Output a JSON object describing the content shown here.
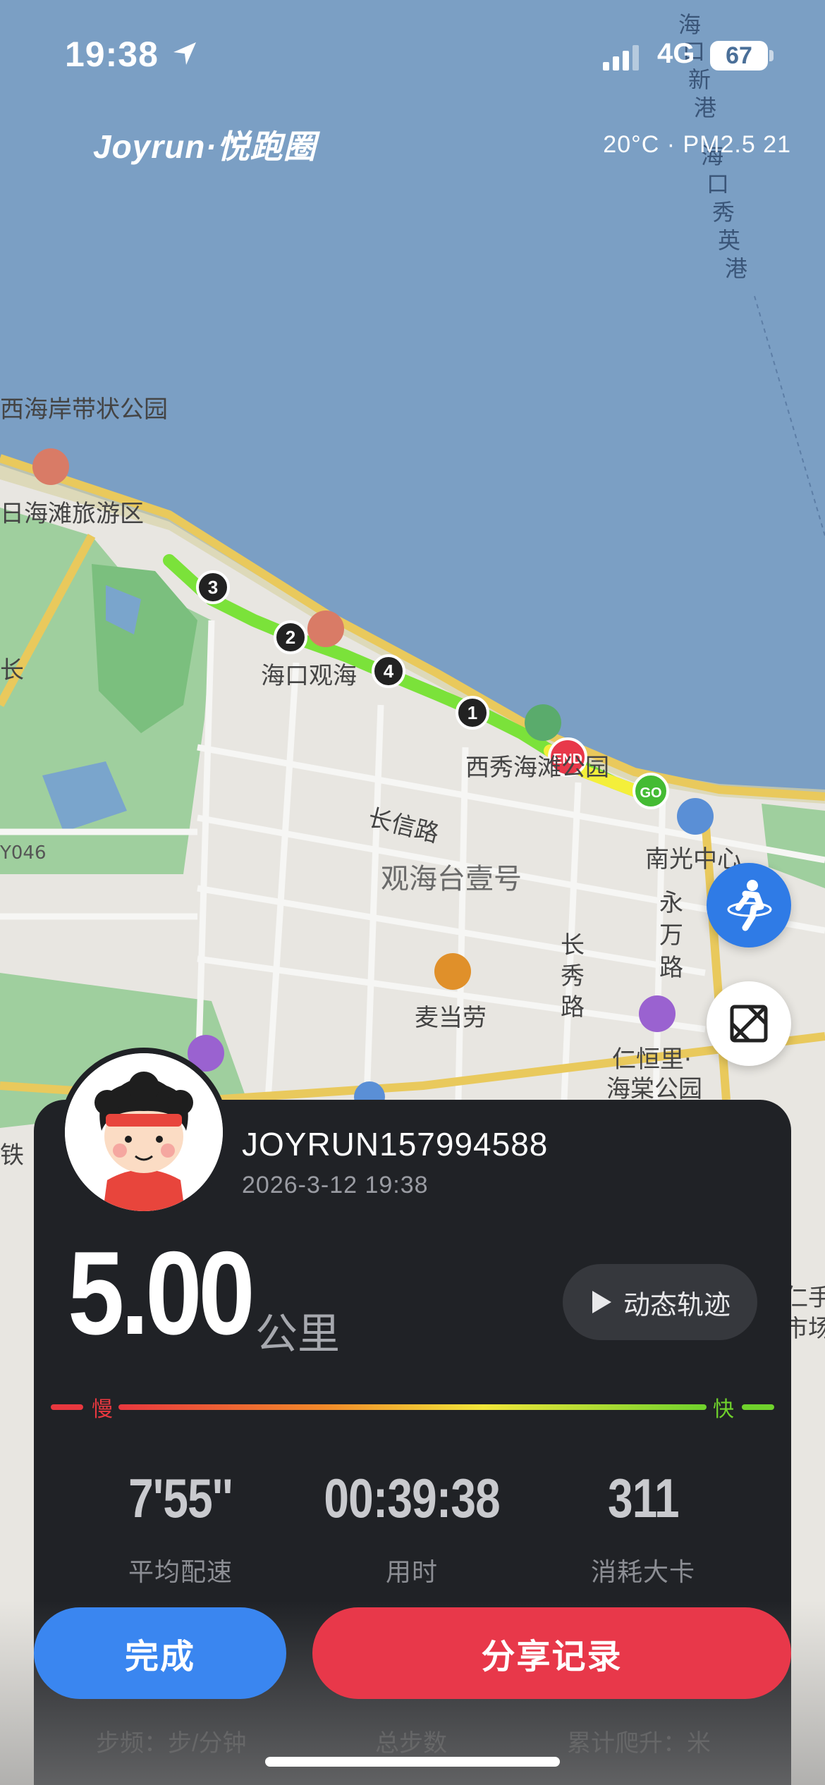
{
  "status_bar": {
    "time": "19:38",
    "network": "4G",
    "battery": "67"
  },
  "header": {
    "brand": "Joyrun·悦跑圈",
    "weather": "20°C · PM2.5 21"
  },
  "map": {
    "labels": {
      "park_west": "西海岸带状公园",
      "beach": "日海滩旅游区",
      "guanhai": "海口观海",
      "xixiu": "西秀海滩公园",
      "changxin": "长信路",
      "guanhaitai": "观海台壹号",
      "changxiu": "长秀路",
      "nanguang": "南光中心",
      "yongwan": "永万路",
      "mcd": "麦当劳",
      "renheng": "仁恒里·",
      "haitang": "海棠公园",
      "port": "海口新港",
      "port2": "海口秀英港",
      "road_046": "Y046",
      "tie": "铁",
      "renshou": "仁手",
      "shichang": "市场",
      "side_char": "长"
    },
    "markers": {
      "start": "GO",
      "end": "END",
      "km": [
        "1",
        "2",
        "3",
        "4"
      ]
    }
  },
  "run": {
    "username": "JOYRUN157994588",
    "datetime": "2026-3-12 19:38",
    "distance": "5.00",
    "unit": "公里",
    "playback_label": "动态轨迹",
    "pace_slow": "慢",
    "pace_fast": "快",
    "stats": [
      {
        "value": "7'55''",
        "label": "平均配速"
      },
      {
        "value": "00:39:38",
        "label": "用时"
      },
      {
        "value": "311",
        "label": "消耗大卡"
      }
    ],
    "more_stats": [
      "步频：步/分钟",
      "总步数",
      "累计爬升：米"
    ]
  },
  "actions": {
    "done": "完成",
    "share": "分享记录"
  },
  "colors": {
    "done": "#3a86f0",
    "share": "#e8384a",
    "route_slow": "#e8383f",
    "route_fast": "#7be23a",
    "card": "#202226"
  }
}
